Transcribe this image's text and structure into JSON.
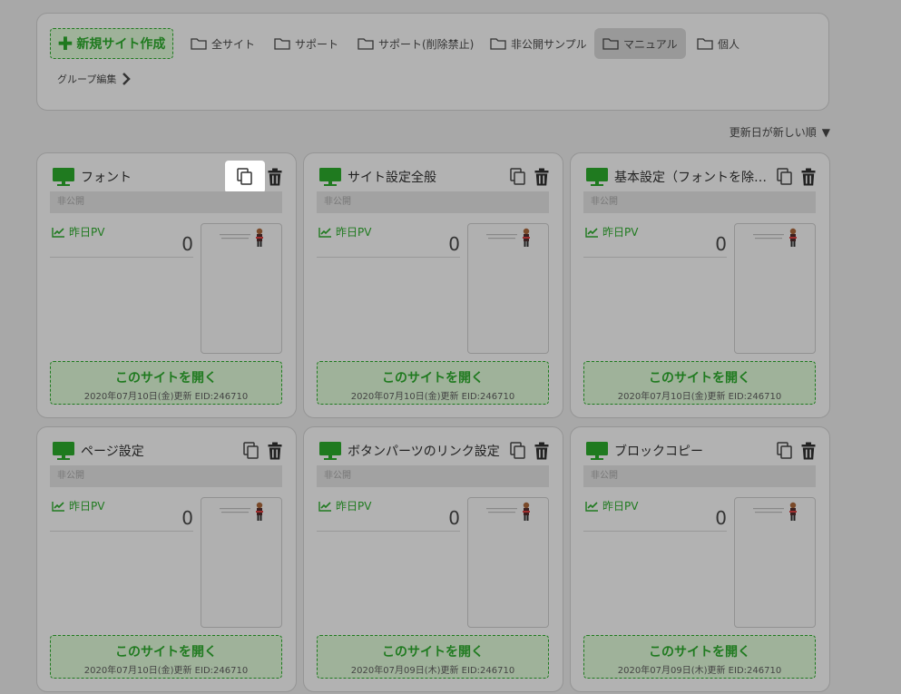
{
  "toolbar": {
    "new_site_label": "新規サイト作成",
    "folders": [
      {
        "label": "全サイト",
        "active": false
      },
      {
        "label": "サポート",
        "active": false
      },
      {
        "label": "サポート(削除禁止)",
        "active": false
      },
      {
        "label": "非公開サンプル",
        "active": false
      },
      {
        "label": "マニュアル",
        "active": true
      },
      {
        "label": "個人",
        "active": false
      }
    ],
    "group_edit_label": "グループ編集"
  },
  "sort": {
    "label": "更新日が新しい順",
    "arrow": "▼"
  },
  "colors": {
    "accent": "#1f7a1f",
    "background": "#a8a8a8",
    "card": "#b2b2b2"
  },
  "cards": [
    {
      "title": "フォント",
      "status": "非公開",
      "pv_label": "昨日PV",
      "pv_value": "0",
      "open_label": "このサイトを開く",
      "meta": "2020年07月10日(金)更新 EID:246710"
    },
    {
      "title": "サイト設定全般",
      "status": "非公開",
      "pv_label": "昨日PV",
      "pv_value": "0",
      "open_label": "このサイトを開く",
      "meta": "2020年07月10日(金)更新 EID:246710"
    },
    {
      "title": "基本設定（フォントを除…",
      "status": "非公開",
      "pv_label": "昨日PV",
      "pv_value": "0",
      "open_label": "このサイトを開く",
      "meta": "2020年07月10日(金)更新 EID:246710"
    },
    {
      "title": "ページ設定",
      "status": "非公開",
      "pv_label": "昨日PV",
      "pv_value": "0",
      "open_label": "このサイトを開く",
      "meta": "2020年07月10日(金)更新 EID:246710"
    },
    {
      "title": "ボタンパーツのリンク設定",
      "status": "非公開",
      "pv_label": "昨日PV",
      "pv_value": "0",
      "open_label": "このサイトを開く",
      "meta": "2020年07月09日(木)更新 EID:246710"
    },
    {
      "title": "ブロックコピー",
      "status": "非公開",
      "pv_label": "昨日PV",
      "pv_value": "0",
      "open_label": "このサイトを開く",
      "meta": "2020年07月09日(木)更新 EID:246710"
    }
  ]
}
